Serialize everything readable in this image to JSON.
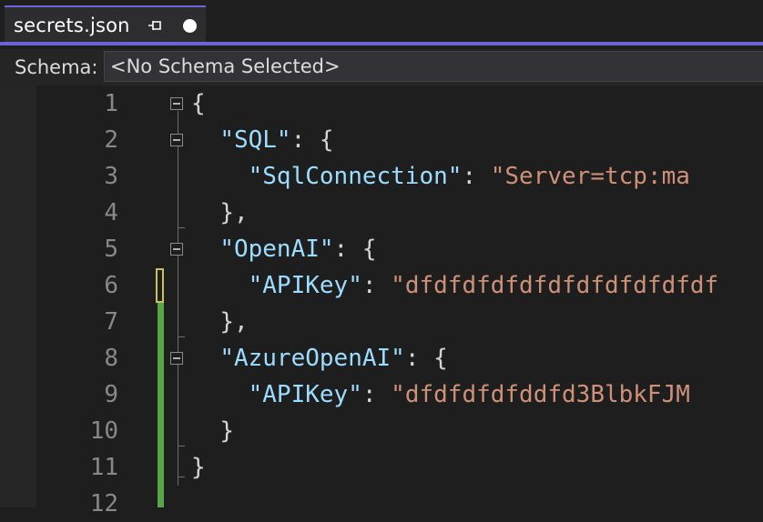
{
  "tab": {
    "title": "secrets.json",
    "pin_icon": "pin-icon",
    "modified_icon": "modified-dot-icon"
  },
  "schema": {
    "label": "Schema:",
    "value": "<No Schema Selected>"
  },
  "colors": {
    "accent": "#6c63d6",
    "key": "#9cdcfe",
    "string": "#ce9178",
    "punctuation": "#d4d4d4",
    "line_number": "#888888",
    "change_saved": "#57a64a",
    "change_unsaved": "#c9c259"
  },
  "editor": {
    "line_numbers": [
      "1",
      "2",
      "3",
      "4",
      "5",
      "6",
      "7",
      "8",
      "9",
      "10",
      "11",
      "12"
    ],
    "lines": [
      {
        "indent": "",
        "key": "",
        "sep": "",
        "value": "",
        "tail": "{"
      },
      {
        "indent": "  ",
        "key": "\"SQL\"",
        "sep": ": ",
        "value": "",
        "tail": "{"
      },
      {
        "indent": "    ",
        "key": "\"SqlConnection\"",
        "sep": ": ",
        "value": "\"Server=tcp:ma",
        "tail": ""
      },
      {
        "indent": "  ",
        "key": "",
        "sep": "",
        "value": "",
        "tail": "},"
      },
      {
        "indent": "  ",
        "key": "\"OpenAI\"",
        "sep": ": ",
        "value": "",
        "tail": "{"
      },
      {
        "indent": "    ",
        "key": "\"APIKey\"",
        "sep": ": ",
        "value": "\"dfdfdfdfdfdfdfdfdfdfdf",
        "tail": ""
      },
      {
        "indent": "  ",
        "key": "",
        "sep": "",
        "value": "",
        "tail": "},"
      },
      {
        "indent": "  ",
        "key": "\"AzureOpenAI\"",
        "sep": ": ",
        "value": "",
        "tail": "{"
      },
      {
        "indent": "    ",
        "key": "\"APIKey\"",
        "sep": ": ",
        "value": "\"dfdfdfdfddfd3BlbkFJM",
        "tail": ""
      },
      {
        "indent": "  ",
        "key": "",
        "sep": "",
        "value": "",
        "tail": "}"
      },
      {
        "indent": "",
        "key": "",
        "sep": "",
        "value": "",
        "tail": "}"
      },
      {
        "indent": "",
        "key": "",
        "sep": "",
        "value": "",
        "tail": ""
      }
    ],
    "fold_icon": "collapse-box-icon"
  }
}
